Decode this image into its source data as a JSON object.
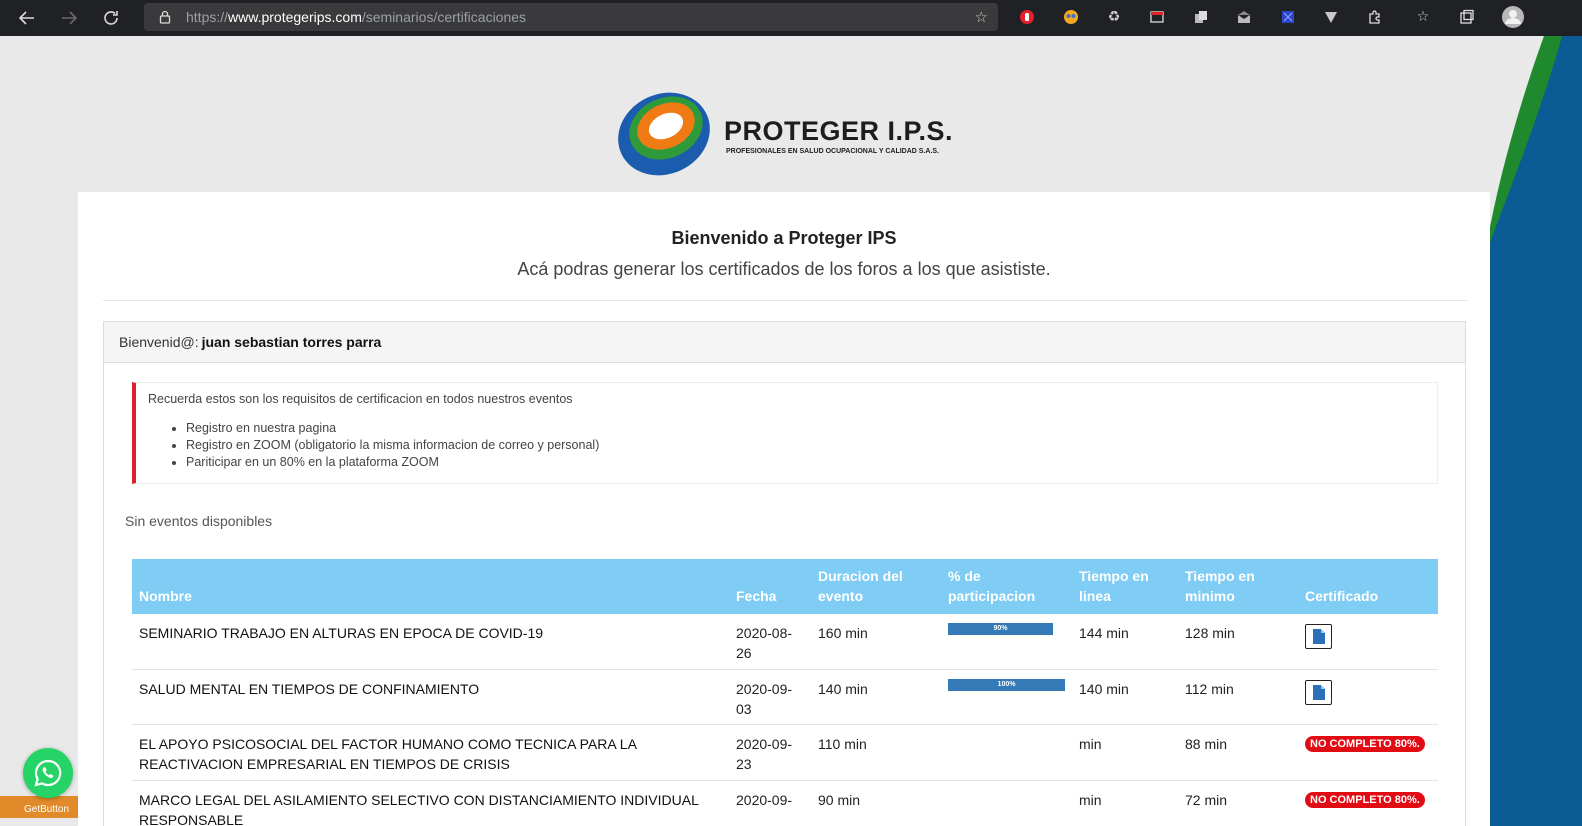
{
  "browser": {
    "url_scheme": "https://",
    "url_host": "www.protegerips.com",
    "url_path": "/seminarios/certificaciones"
  },
  "logo": {
    "title": "PROTEGER I.P.S.",
    "subtitle": "PROFESIONALES EN SALUD OCUPACIONAL Y CALIDAD S.A.S."
  },
  "header": {
    "title": "Bienvenido a Proteger IPS",
    "subtitle": "Acá podras generar los certificados de los foros a los que asististe."
  },
  "panel": {
    "greeting": "Bienvenid@:",
    "user_name": "juan sebastian torres parra"
  },
  "notice": {
    "intro": "Recuerda estos son los requisitos de certificacion en todos nuestros eventos",
    "items": [
      "Registro en nuestra pagina",
      "Registro en ZOOM (obligatorio la misma informacion de correo y personal)",
      "Pariticipar en un 80% en la plataforma ZOOM"
    ]
  },
  "no_events_text": "Sin eventos disponibles",
  "table": {
    "headers": {
      "nombre": "Nombre",
      "fecha": "Fecha",
      "duracion": "Duracion del evento",
      "participacion": "% de participacion",
      "tiempo_linea": "Tiempo en linea",
      "tiempo_minimo": "Tiempo en minimo",
      "certificado": "Certificado"
    },
    "rows": [
      {
        "nombre": "SEMINARIO TRABAJO EN ALTURAS EN EPOCA DE COVID-19",
        "fecha": "2020-08-26",
        "duracion": "160 min",
        "participacion_label": "90%",
        "participacion": 0.9,
        "tiempo_linea": "144 min",
        "tiempo_minimo": "128 min",
        "certificado": "download"
      },
      {
        "nombre": "SALUD MENTAL EN TIEMPOS DE CONFINAMIENTO",
        "fecha": "2020-09-03",
        "duracion": "140 min",
        "participacion_label": "100%",
        "participacion": 1.0,
        "tiempo_linea": "140 min",
        "tiempo_minimo": "112 min",
        "certificado": "download"
      },
      {
        "nombre": "EL APOYO PSICOSOCIAL DEL FACTOR HUMANO COMO TECNICA PARA LA REACTIVACION EMPRESARIAL EN TIEMPOS DE CRISIS",
        "fecha": "2020-09-23",
        "duracion": "110 min",
        "participacion_label": "",
        "tiempo_linea": "min",
        "tiempo_minimo": "88 min",
        "certificado": "NO COMPLETO 80%."
      },
      {
        "nombre": "MARCO LEGAL DEL ASILAMIENTO SELECTIVO CON DISTANCIAMIENTO INDIVIDUAL RESPONSABLE",
        "fecha": "2020-09-",
        "duracion": "90 min",
        "participacion_label": "",
        "tiempo_linea": "min",
        "tiempo_minimo": "72 min",
        "certificado": "NO COMPLETO 80%."
      }
    ]
  },
  "whatsapp": {
    "label": "GetButton",
    "color": "#25d366"
  },
  "colors": {
    "table_header": "#7fccf4",
    "progress": "#337ab7",
    "badge": "#e20b14",
    "notice_border": "#d9232d"
  }
}
